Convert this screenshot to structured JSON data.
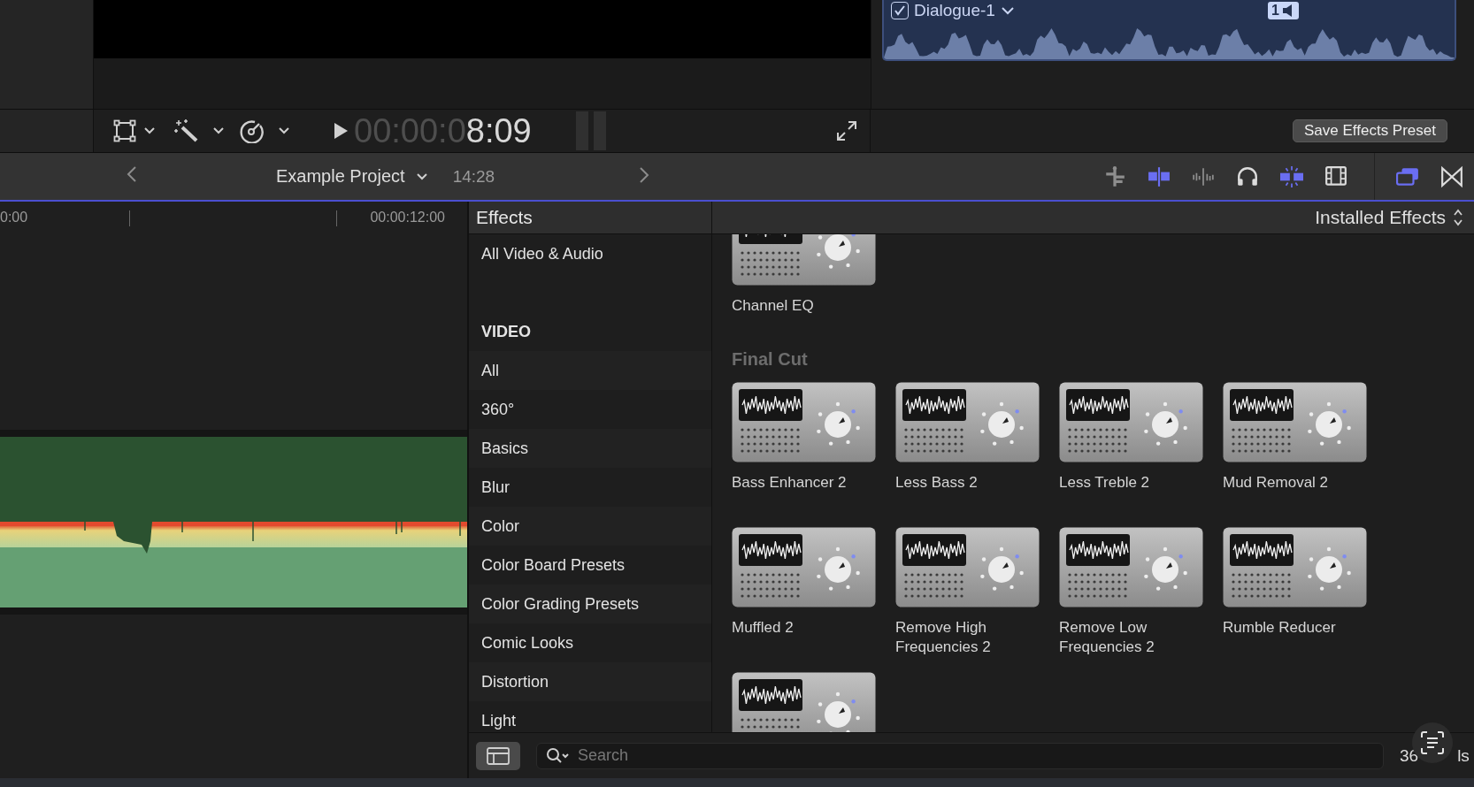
{
  "inspector_clip": {
    "name": "Dialogue-1",
    "checked": true,
    "badge": "1"
  },
  "viewer": {
    "timecode_dim": "00:00:0",
    "timecode_bright": "8:09"
  },
  "inspector": {
    "button": "Save Effects Preset"
  },
  "project_bar": {
    "title": "Example Project",
    "duration": "14:28"
  },
  "toolbar": [
    {
      "kind": "connect",
      "on": false,
      "disabled": true
    },
    {
      "kind": "skim",
      "on": true,
      "disabled": false
    },
    {
      "kind": "audio-skim",
      "on": false,
      "disabled": true
    },
    {
      "kind": "solo",
      "on": false,
      "disabled": false
    },
    {
      "kind": "snap",
      "on": true,
      "disabled": false
    },
    {
      "kind": "filmstrip",
      "on": false,
      "disabled": false
    },
    {
      "kind": "browser",
      "on": true,
      "disabled": false
    },
    {
      "kind": "transitions",
      "on": false,
      "disabled": false
    }
  ],
  "timeline": {
    "ruler": [
      "0:00",
      "00:00:12:00"
    ]
  },
  "effects": {
    "title": "Effects",
    "filter": "Installed Effects",
    "categories": [
      {
        "kind": "item",
        "label": "All Video & Audio",
        "selected": false
      },
      {
        "kind": "header",
        "label": "VIDEO"
      },
      {
        "kind": "item",
        "label": "All",
        "selected": false
      },
      {
        "kind": "item",
        "label": "360°",
        "selected": false
      },
      {
        "kind": "item",
        "label": "Basics",
        "selected": false
      },
      {
        "kind": "item",
        "label": "Blur",
        "selected": false
      },
      {
        "kind": "item",
        "label": "Color",
        "selected": false
      },
      {
        "kind": "item",
        "label": "Color Board Presets",
        "selected": false
      },
      {
        "kind": "item",
        "label": "Color Grading Presets",
        "selected": false
      },
      {
        "kind": "item",
        "label": "Comic Looks",
        "selected": false
      },
      {
        "kind": "item",
        "label": "Distortion",
        "selected": false
      },
      {
        "kind": "item",
        "label": "Light",
        "selected": false
      }
    ],
    "sections": [
      {
        "items": [
          {
            "kind": "effect",
            "label": "Channel EQ"
          }
        ]
      },
      {
        "title": "Final Cut",
        "items": [
          {
            "kind": "effect",
            "label": "Bass Enhancer 2"
          },
          {
            "kind": "effect",
            "label": "Less Bass 2"
          },
          {
            "kind": "effect",
            "label": "Less Treble 2"
          },
          {
            "kind": "effect",
            "label": "Mud Removal 2"
          },
          {
            "kind": "effect",
            "label": "Muffled 2"
          },
          {
            "kind": "effect",
            "label": "Remove High Frequencies 2"
          },
          {
            "kind": "effect",
            "label": "Remove Low Frequencies 2"
          },
          {
            "kind": "effect",
            "label": "Rumble Reducer"
          },
          {
            "kind": "effect"
          }
        ]
      }
    ],
    "search": {
      "placeholder": "Search"
    },
    "count": "36",
    "count_tail": "ls"
  }
}
